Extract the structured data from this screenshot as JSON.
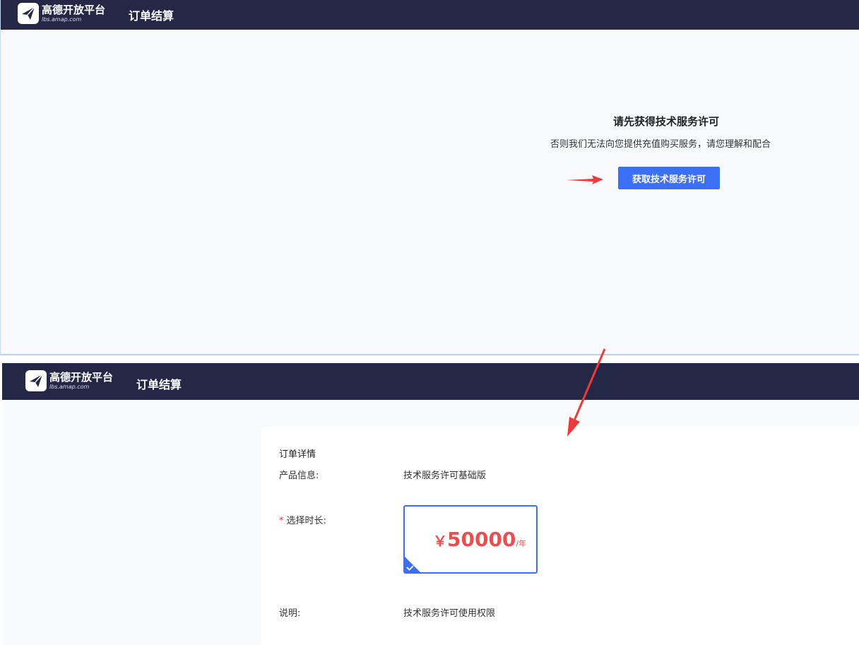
{
  "brand": {
    "name": "高德开放平台",
    "domain": "lbs.amap.com"
  },
  "colors": {
    "header": "#242846",
    "accent": "#3b6ff6",
    "price": "#ea4f4f",
    "arrow": "#ee3a3a"
  },
  "step1": {
    "page_title": "订单结算",
    "notice_title": "请先获得技术服务许可",
    "notice_text": "否则我们无法向您提供充值购买服务，请您理解和配合",
    "action_label": "获取技术服务许可"
  },
  "step2": {
    "page_title": "订单结算",
    "order": {
      "section_title": "订单详情",
      "product_label": "产品信息:",
      "product_value": "技术服务许可基础版",
      "required_mark": "*",
      "duration_label": "选择时长:",
      "price": {
        "currency": "￥",
        "amount": "50000",
        "unit": "/年",
        "selected": true
      },
      "desc_label": "说明:",
      "desc_value": "技术服务许可使用权限"
    }
  },
  "icons": {
    "logo": "paper-plane-logo-icon",
    "selected": "check-icon",
    "pointer": "red-arrow-icon"
  }
}
